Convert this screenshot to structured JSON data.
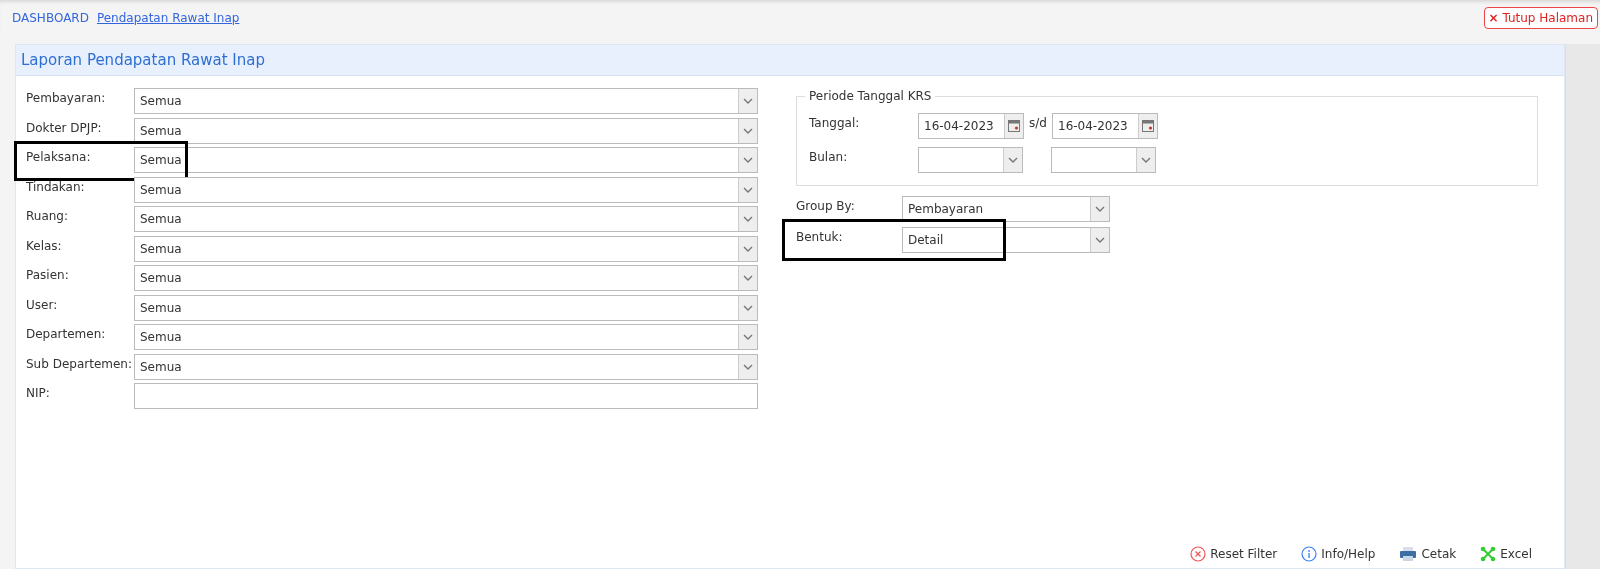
{
  "breadcrumb": [
    {
      "label": "DASHBOARD",
      "kind": "plain"
    },
    {
      "label": "Pendapatan Rawat Inap",
      "kind": "link"
    }
  ],
  "close_button": {
    "icon": "×",
    "label": "Tutup Halaman"
  },
  "panel": {
    "title": "Laporan Pendapatan Rawat Inap"
  },
  "filters": [
    {
      "label": "Pembayaran:",
      "kind": "select",
      "value": "Semua",
      "highlighted": false
    },
    {
      "label": "Dokter DPJP:",
      "kind": "select",
      "value": "Semua",
      "highlighted": false
    },
    {
      "label": "Pelaksana:",
      "kind": "select",
      "value": "Semua",
      "highlighted": true
    },
    {
      "label": "Tindakan:",
      "kind": "select",
      "value": "Semua",
      "highlighted": false
    },
    {
      "label": "Ruang:",
      "kind": "select",
      "value": "Semua",
      "highlighted": false
    },
    {
      "label": "Kelas:",
      "kind": "select",
      "value": "Semua",
      "highlighted": false
    },
    {
      "label": "Pasien:",
      "kind": "select",
      "value": "Semua",
      "highlighted": false
    },
    {
      "label": "User:",
      "kind": "select",
      "value": "Semua",
      "highlighted": false
    },
    {
      "label": "Departemen:",
      "kind": "select",
      "value": "Semua",
      "highlighted": false
    },
    {
      "label": "Sub Departemen:",
      "kind": "select",
      "value": "Semua",
      "highlighted": false
    },
    {
      "label": "NIP:",
      "kind": "text",
      "highlighted": false
    }
  ],
  "periode": {
    "legend": "Periode Tanggal KRS",
    "tanggal_label": "Tanggal:",
    "date_from": "16-04-2023",
    "separator": "s/d",
    "date_to": "16-04-2023",
    "bulan_label": "Bulan:"
  },
  "options": [
    {
      "label": "Group By:",
      "value": "Pembayaran",
      "highlighted": false
    },
    {
      "label": "Bentuk:",
      "value": "Detail",
      "highlighted": true
    }
  ],
  "actions": [
    {
      "kind": "reset",
      "label": "Reset Filter"
    },
    {
      "kind": "info",
      "label": "Info/Help"
    },
    {
      "kind": "print",
      "label": "Cetak"
    },
    {
      "kind": "excel",
      "label": "Excel"
    }
  ]
}
